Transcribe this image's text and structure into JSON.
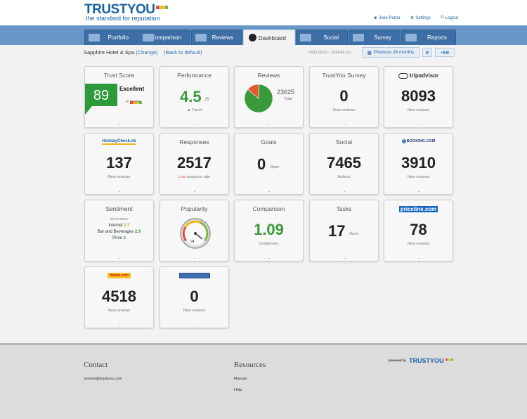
{
  "header": {
    "logo_text": "TRUSTYOU",
    "tagline": "the standard for reputation",
    "user": "Julie Porter",
    "settings": "Settings",
    "logout": "Logout"
  },
  "nav": {
    "tabs": [
      {
        "label": "Portfolio"
      },
      {
        "label": "Comparison"
      },
      {
        "label": "Reviews"
      },
      {
        "label": "Dashboard"
      },
      {
        "label": "Social"
      },
      {
        "label": "Survey"
      },
      {
        "label": "Reports"
      }
    ]
  },
  "subbar": {
    "hotel": "Sapphire Hotel & Spa",
    "change": "(Change)",
    "back": "(Back to default)",
    "daterange": "(2012-02-01 – 2014-01-31)",
    "period_button": "Previous 24 months"
  },
  "tiles": {
    "trust_score": {
      "title": "Trust Score",
      "score": "89",
      "rating": "Excellent",
      "byline": "by TrustYou"
    },
    "performance": {
      "title": "Performance",
      "value": "4.5",
      "scale": "/5",
      "trend": "Trend"
    },
    "reviews": {
      "title": "Reviews",
      "total": "23625",
      "total_label": "Total"
    },
    "survey": {
      "title": "TrustYou Survey",
      "value": "0",
      "label": "New reviews"
    },
    "tripadvisor": {
      "brand": "tripadvisor",
      "value": "8093",
      "label": "New reviews"
    },
    "holidaycheck": {
      "brand": "HolidayCheck.de",
      "value": "137",
      "label": "New reviews"
    },
    "responses": {
      "title": "Responses",
      "value": "2517",
      "low": "Low",
      "label": "response rate"
    },
    "goals": {
      "title": "Goals",
      "value": "0",
      "label": "Open"
    },
    "social": {
      "title": "Social",
      "value": "7465",
      "label": "Actions"
    },
    "booking": {
      "brand": "BOOKING.COM",
      "value": "3910",
      "label": "New reviews"
    },
    "sentiment": {
      "title": "Sentiment",
      "worst": "Worst Rated:",
      "rows": [
        {
          "name": "Internet",
          "score": "2.7"
        },
        {
          "name": "Bar and Beverages",
          "score": "2.9"
        },
        {
          "name": "Price",
          "score": "3"
        }
      ]
    },
    "popularity": {
      "title": "Popularity",
      "gauge_value": "94"
    },
    "comparison": {
      "title": "Comparison",
      "value": "1.09",
      "label": "CompIndex"
    },
    "tasks": {
      "title": "Tasks",
      "value": "17",
      "label": "Open"
    },
    "priceline": {
      "brand": "priceline.com",
      "value": "78",
      "label": "New reviews"
    },
    "hotels": {
      "brand": "Hotels.com",
      "value": "4518",
      "label": "New reviews"
    },
    "other": {
      "brand": "",
      "value": "0",
      "label": "New reviews"
    }
  },
  "footer": {
    "contact_title": "Contact",
    "email": "service@trustyou.com",
    "resources_title": "Resources",
    "manual": "Manual",
    "help": "Help",
    "powered_by": "powered by",
    "powered_brand": "TRUSTYOU"
  },
  "colors": {
    "brand_blue": "#1b62a5",
    "nav_blue": "#6896c7",
    "green": "#3a9a3a",
    "low_red": "#d9534f",
    "score_yellow": "#d6a800"
  },
  "chart_data": {
    "type": "pie",
    "categories": [
      "",
      ""
    ],
    "values": [
      86,
      14
    ]
  }
}
